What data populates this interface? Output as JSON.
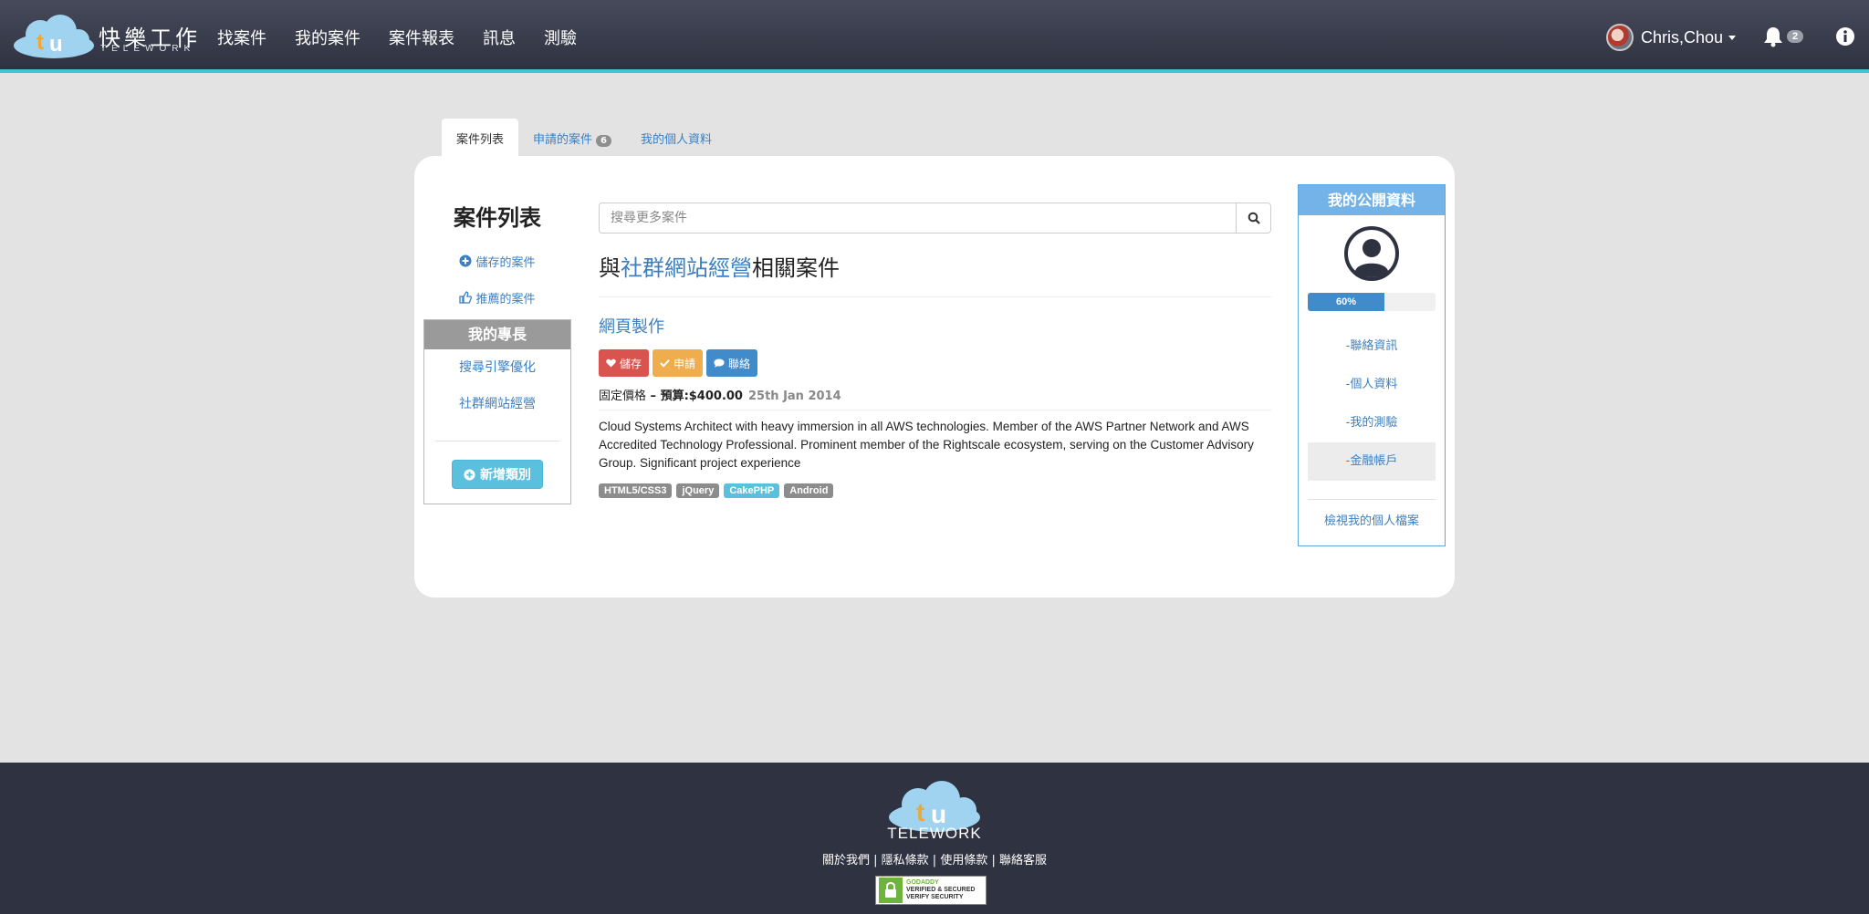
{
  "header": {
    "logo_cn": "快樂工作",
    "logo_en": "TELEWORK",
    "nav": [
      "找案件",
      "我的案件",
      "案件報表",
      "訊息",
      "測驗"
    ],
    "user_name": "Chris,Chou",
    "notification_count": "2"
  },
  "tabs": [
    {
      "label": "案件列表",
      "active": true
    },
    {
      "label": "申請的案件",
      "badge": "6"
    },
    {
      "label": "我的個人資料"
    }
  ],
  "left": {
    "title": "案件列表",
    "saved_link": "儲存的案件",
    "recommended_link": "推薦的案件",
    "skills_title": "我的專長",
    "skills": [
      "搜尋引擎優化",
      "社群網站經營"
    ],
    "add_button": "新增類別"
  },
  "center": {
    "search_placeholder": "搜尋更多案件",
    "heading_prefix": "與",
    "heading_keyword": "社群網站經營",
    "heading_suffix": "相關案件",
    "job": {
      "title": "網頁製作",
      "save_label": "儲存",
      "apply_label": "申請",
      "contact_label": "聯絡",
      "price_label": "固定價格",
      "budget_text": " – 預算:$400.00",
      "date": "25th Jan 2014",
      "description": "Cloud Systems Architect with heavy immersion in all AWS technologies. Member of the AWS Partner Network and AWS Accredited Technology Professional. Prominent member of the Rightscale ecosystem, serving on the Customer Advisory Group. Significant project experience",
      "tags": [
        {
          "label": "HTML5/CSS3",
          "style": "default"
        },
        {
          "label": "jQuery",
          "style": "default"
        },
        {
          "label": "CakePHP",
          "style": "info"
        },
        {
          "label": "Android",
          "style": "default"
        }
      ]
    }
  },
  "right": {
    "title": "我的公開資料",
    "progress_percent": 60,
    "progress_label": "60%",
    "links": [
      {
        "label": "-聯絡資訊"
      },
      {
        "label": "-個人資料"
      },
      {
        "label": "-我的測驗"
      },
      {
        "label": "-金融帳戶",
        "active": true
      }
    ],
    "view_profile": "檢視我的個人檔案"
  },
  "footer": {
    "logo_text": "TELEWORK",
    "links": [
      "關於我們",
      "隱私條款",
      "使用條款",
      "聯絡客服"
    ],
    "separator": " | ",
    "seal_line1": "GODADDY",
    "seal_line2": "VERIFIED & SECURED",
    "seal_line3": "VERIFY SECURITY"
  },
  "colors": {
    "accent": "#3ec6d8",
    "link": "#3d7fc1",
    "nav_bg": "#2f3241"
  }
}
